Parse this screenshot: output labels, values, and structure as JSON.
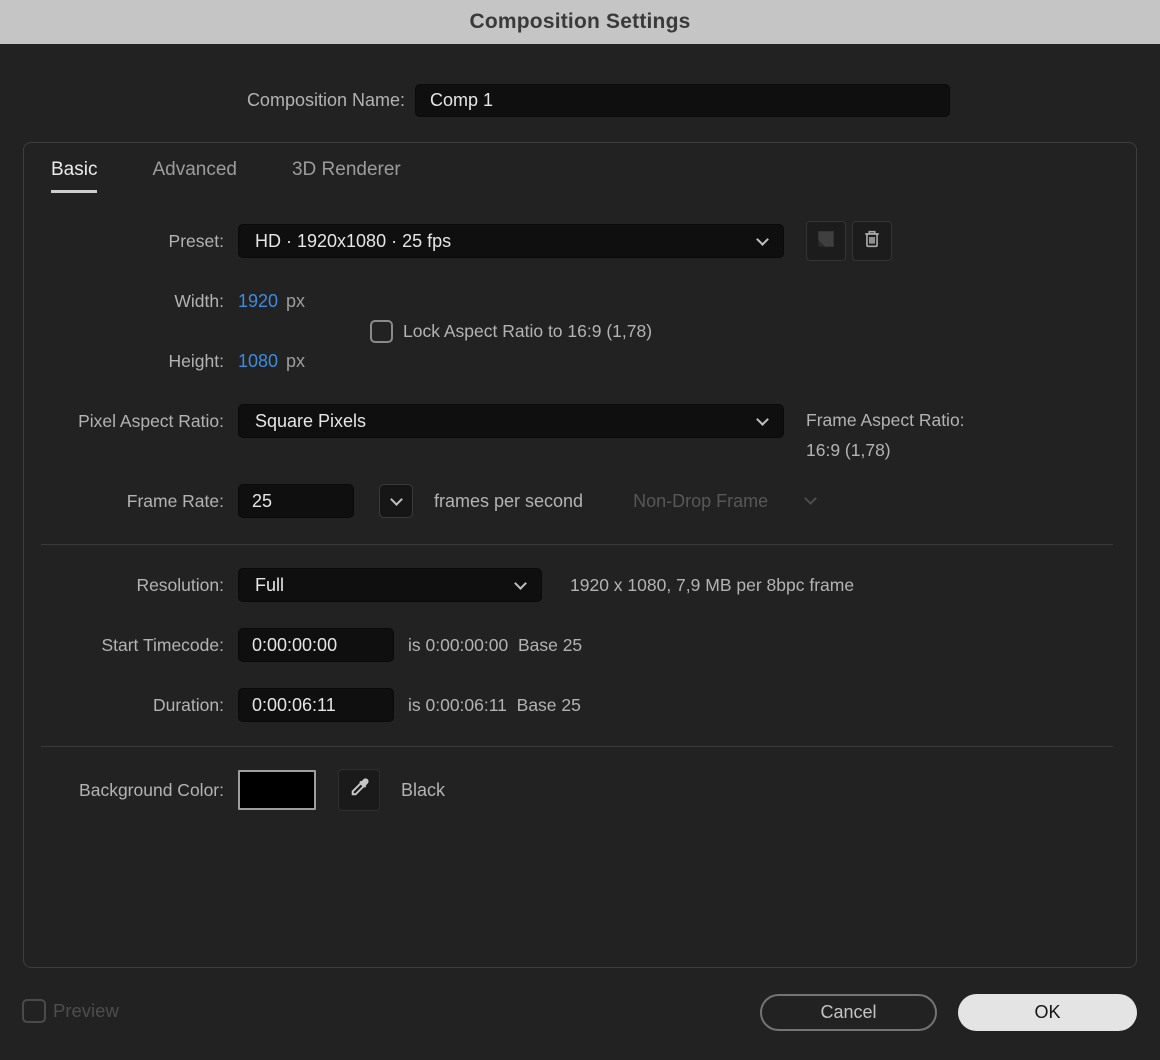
{
  "window": {
    "title": "Composition Settings"
  },
  "colors": {
    "titlebar_bg": "#c5c5c5",
    "dialog_bg": "#222222",
    "panel_border": "#3d3d3d",
    "input_bg": "#0f0f0f",
    "accent_blue": "#3c8ce0",
    "label_text": "#b3b3b3",
    "value_text": "#e6e6e6",
    "disabled_text": "#575757",
    "separator": "#3a3a3a",
    "ok_bg": "#e4e4e4",
    "cancel_border": "#747474"
  },
  "composition_name": {
    "label": "Composition Name:",
    "value": "Comp 1"
  },
  "tabs": {
    "items": [
      {
        "label": "Basic",
        "active": true
      },
      {
        "label": "Advanced",
        "active": false
      },
      {
        "label": "3D Renderer",
        "active": false
      }
    ]
  },
  "preset": {
    "label": "Preset:",
    "value": "HD · 1920x1080 · 25 fps",
    "new_icon": "new-preset-icon",
    "delete_icon": "trash-icon"
  },
  "dimensions": {
    "width_label": "Width:",
    "width_value": "1920",
    "width_unit": "px",
    "height_label": "Height:",
    "height_value": "1080",
    "height_unit": "px",
    "lock_label": "Lock Aspect Ratio to 16:9 (1,78)",
    "lock_checked": false
  },
  "pixel_aspect_ratio": {
    "label": "Pixel Aspect Ratio:",
    "value": "Square Pixels",
    "frame_aspect_label": "Frame Aspect Ratio:",
    "frame_aspect_value": "16:9 (1,78)"
  },
  "frame_rate": {
    "label": "Frame Rate:",
    "value": "25",
    "unit_text": "frames per second",
    "drop_frame_value": "Non-Drop Frame",
    "drop_frame_disabled": true
  },
  "resolution": {
    "label": "Resolution:",
    "value": "Full",
    "info": "1920 x 1080, 7,9 MB per 8bpc frame"
  },
  "start_timecode": {
    "label": "Start Timecode:",
    "value": "0:00:00:00",
    "info": "is 0:00:00:00  Base 25"
  },
  "duration": {
    "label": "Duration:",
    "value": "0:00:06:11",
    "info": "is 0:00:06:11  Base 25"
  },
  "background_color": {
    "label": "Background Color:",
    "swatch_color": "#000000",
    "color_name": "Black",
    "eyedropper_icon": "eyedropper-icon"
  },
  "footer": {
    "preview_label": "Preview",
    "preview_checked": false,
    "cancel_label": "Cancel",
    "ok_label": "OK"
  }
}
